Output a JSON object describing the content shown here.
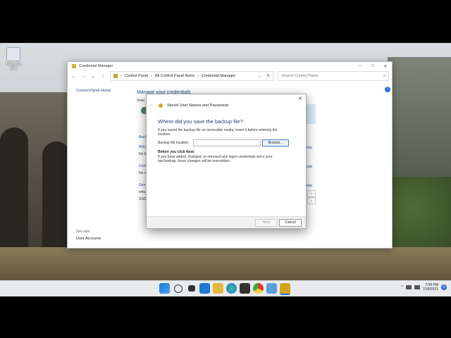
{
  "desktop": {
    "recycle_bin_label": "Recycle Bin"
  },
  "window": {
    "title": "Credential Manager",
    "controls": {
      "minimize": "–",
      "maximize": "□",
      "close": "✕"
    },
    "nav": {
      "back": "←",
      "forward": "→",
      "recent": "⌄",
      "up": "↑"
    },
    "breadcrumb": [
      "Control Panel",
      "All Control Panel Items",
      "Credential Manager"
    ],
    "breadcrumb_sep": "›",
    "refresh": "↻",
    "search_placeholder": "Search Control Panel",
    "search_icon": "⌕",
    "left_pane": {
      "home_link": "Control Panel Home",
      "see_also": "See also",
      "user_accounts": "User Accounts"
    },
    "main_heading": "Manage your credentials",
    "view_label": "View",
    "help_icon": "?",
    "fragments": {
      "back": "Back",
      "win": "Wind",
      "no1": "No W",
      "cert": "Certi",
      "no2": "No c",
      "gen": "Gen",
      "virt": "virtu",
      "sso": "SSO"
    },
    "right_links": [
      "dential",
      "dential",
      "dential"
    ],
    "chevron": "⌄"
  },
  "dialog": {
    "close": "✕",
    "back_arrow": "←",
    "header": "Stored User Names and Passwords",
    "title": "Where did you save the backup file?",
    "description": "If you saved the backup file on removable media, insert it before entering the location.",
    "location_label": "Backup file location:",
    "location_value": "",
    "browse_label": "Browse...",
    "before_heading": "Before you click Next:",
    "before_text": "If you have added, changed, or removed any logon credentials since your last backup, those changes will be overwritten.",
    "next_label": "Next",
    "cancel_label": "Cancel"
  },
  "taskbar": {
    "icons": [
      "windows-start-icon",
      "search-icon",
      "task-view-icon",
      "widgets-icon",
      "file-explorer-icon",
      "edge-icon",
      "store-icon",
      "chrome-icon",
      "control-panel-icon",
      "credential-manager-icon"
    ],
    "tray_chevron": "^",
    "time": "7:59 PM",
    "date": "7/18/2021",
    "notification_count": "6"
  }
}
